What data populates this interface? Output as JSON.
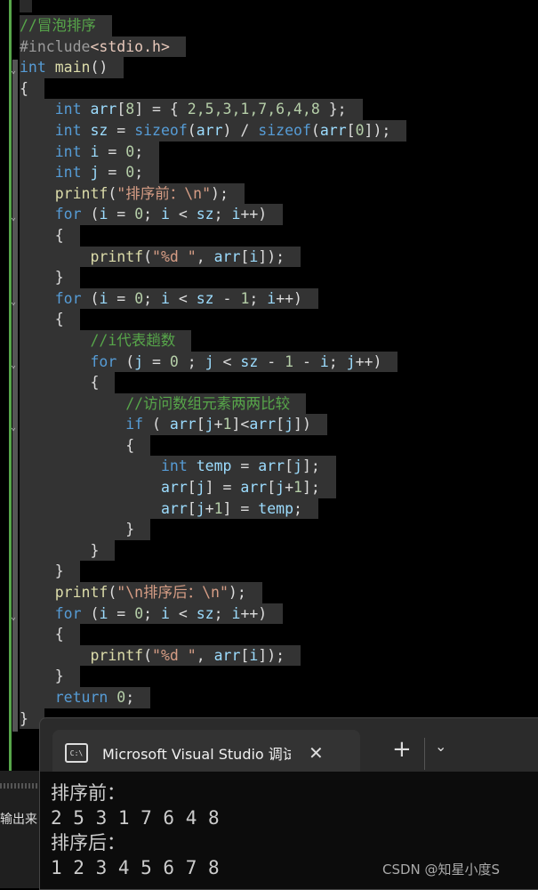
{
  "editor": {
    "lines": [
      [
        [
          0,
          "//冒泡排序",
          "cm"
        ]
      ],
      [
        [
          0,
          "#include",
          "pp"
        ],
        [
          0,
          "<stdio.h>",
          "inc"
        ]
      ],
      [
        [
          0,
          "int ",
          "kw"
        ],
        [
          0,
          "main",
          "fn"
        ],
        [
          0,
          "()",
          "p"
        ]
      ],
      [
        [
          0,
          "{",
          "p"
        ]
      ],
      [
        [
          1,
          "int ",
          "kw"
        ],
        [
          1,
          "arr",
          "var"
        ],
        [
          1,
          "[",
          "p"
        ],
        [
          1,
          "8",
          "num"
        ],
        [
          1,
          "] = { ",
          "p"
        ],
        [
          1,
          "2,5,3,1,7,6,4,8",
          "num"
        ],
        [
          1,
          " };",
          "p"
        ]
      ],
      [
        [
          1,
          "int ",
          "kw"
        ],
        [
          1,
          "sz",
          "var"
        ],
        [
          1,
          " = ",
          "p"
        ],
        [
          1,
          "sizeof",
          "kw"
        ],
        [
          1,
          "(",
          "p"
        ],
        [
          1,
          "arr",
          "var"
        ],
        [
          1,
          ") / ",
          "p"
        ],
        [
          1,
          "sizeof",
          "kw"
        ],
        [
          1,
          "(",
          "p"
        ],
        [
          1,
          "arr",
          "var"
        ],
        [
          1,
          "[",
          "p"
        ],
        [
          1,
          "0",
          "num"
        ],
        [
          1,
          "]);",
          "p"
        ]
      ],
      [
        [
          1,
          "int ",
          "kw"
        ],
        [
          1,
          "i",
          "var"
        ],
        [
          1,
          " = ",
          "p"
        ],
        [
          1,
          "0",
          "num"
        ],
        [
          1,
          ";",
          "p"
        ]
      ],
      [
        [
          1,
          "int ",
          "kw"
        ],
        [
          1,
          "j",
          "var"
        ],
        [
          1,
          " = ",
          "p"
        ],
        [
          1,
          "0",
          "num"
        ],
        [
          1,
          ";",
          "p"
        ]
      ],
      [
        [
          1,
          "printf",
          "fn"
        ],
        [
          1,
          "(",
          "p"
        ],
        [
          1,
          "\"排序前：\\n\"",
          "str"
        ],
        [
          1,
          ");",
          "p"
        ]
      ],
      [
        [
          1,
          "for ",
          "kw"
        ],
        [
          1,
          "(",
          "p"
        ],
        [
          1,
          "i",
          "var"
        ],
        [
          1,
          " = ",
          "p"
        ],
        [
          1,
          "0",
          "num"
        ],
        [
          1,
          "; ",
          "p"
        ],
        [
          1,
          "i",
          "var"
        ],
        [
          1,
          " < ",
          "p"
        ],
        [
          1,
          "sz",
          "var"
        ],
        [
          1,
          "; ",
          "p"
        ],
        [
          1,
          "i",
          "var"
        ],
        [
          1,
          "++)",
          "p"
        ]
      ],
      [
        [
          1,
          "{",
          "p"
        ]
      ],
      [
        [
          2,
          "printf",
          "fn"
        ],
        [
          2,
          "(",
          "p"
        ],
        [
          2,
          "\"%d \"",
          "str"
        ],
        [
          2,
          ", ",
          "p"
        ],
        [
          2,
          "arr",
          "var"
        ],
        [
          2,
          "[",
          "p"
        ],
        [
          2,
          "i",
          "var"
        ],
        [
          2,
          "]);",
          "p"
        ]
      ],
      [
        [
          1,
          "}",
          "p"
        ]
      ],
      [
        [
          1,
          "for ",
          "kw"
        ],
        [
          1,
          "(",
          "p"
        ],
        [
          1,
          "i",
          "var"
        ],
        [
          1,
          " = ",
          "p"
        ],
        [
          1,
          "0",
          "num"
        ],
        [
          1,
          "; ",
          "p"
        ],
        [
          1,
          "i",
          "var"
        ],
        [
          1,
          " < ",
          "p"
        ],
        [
          1,
          "sz",
          "var"
        ],
        [
          1,
          " - ",
          "p"
        ],
        [
          1,
          "1",
          "num"
        ],
        [
          1,
          "; ",
          "p"
        ],
        [
          1,
          "i",
          "var"
        ],
        [
          1,
          "++)",
          "p"
        ]
      ],
      [
        [
          1,
          "{",
          "p"
        ]
      ],
      [
        [
          2,
          "//i代表趟数",
          "cm"
        ]
      ],
      [
        [
          2,
          "for ",
          "kw"
        ],
        [
          2,
          "(",
          "p"
        ],
        [
          2,
          "j",
          "var"
        ],
        [
          2,
          " = ",
          "p"
        ],
        [
          2,
          "0",
          "num"
        ],
        [
          2,
          " ; ",
          "p"
        ],
        [
          2,
          "j",
          "var"
        ],
        [
          2,
          " < ",
          "p"
        ],
        [
          2,
          "sz",
          "var"
        ],
        [
          2,
          " - ",
          "p"
        ],
        [
          2,
          "1",
          "num"
        ],
        [
          2,
          " - ",
          "p"
        ],
        [
          2,
          "i",
          "var"
        ],
        [
          2,
          "; ",
          "p"
        ],
        [
          2,
          "j",
          "var"
        ],
        [
          2,
          "++)",
          "p"
        ]
      ],
      [
        [
          2,
          "{",
          "p"
        ]
      ],
      [
        [
          3,
          "//访问数组元素两两比较",
          "cm"
        ]
      ],
      [
        [
          3,
          "if ",
          "kw"
        ],
        [
          3,
          "( ",
          "p"
        ],
        [
          3,
          "arr",
          "var"
        ],
        [
          3,
          "[",
          "p"
        ],
        [
          3,
          "j",
          "var"
        ],
        [
          3,
          "+",
          "p"
        ],
        [
          3,
          "1",
          "num"
        ],
        [
          3,
          "]<",
          "p"
        ],
        [
          3,
          "arr",
          "var"
        ],
        [
          3,
          "[",
          "p"
        ],
        [
          3,
          "j",
          "var"
        ],
        [
          3,
          "])",
          "p"
        ]
      ],
      [
        [
          3,
          "{",
          "p"
        ]
      ],
      [
        [
          4,
          "int ",
          "kw"
        ],
        [
          4,
          "temp",
          "var"
        ],
        [
          4,
          " = ",
          "p"
        ],
        [
          4,
          "arr",
          "var"
        ],
        [
          4,
          "[",
          "p"
        ],
        [
          4,
          "j",
          "var"
        ],
        [
          4,
          "];",
          "p"
        ]
      ],
      [
        [
          4,
          "arr",
          "var"
        ],
        [
          4,
          "[",
          "p"
        ],
        [
          4,
          "j",
          "var"
        ],
        [
          4,
          "] = ",
          "p"
        ],
        [
          4,
          "arr",
          "var"
        ],
        [
          4,
          "[",
          "p"
        ],
        [
          4,
          "j",
          "var"
        ],
        [
          4,
          "+",
          "p"
        ],
        [
          4,
          "1",
          "num"
        ],
        [
          4,
          "];",
          "p"
        ]
      ],
      [
        [
          4,
          "arr",
          "var"
        ],
        [
          4,
          "[",
          "p"
        ],
        [
          4,
          "j",
          "var"
        ],
        [
          4,
          "+",
          "p"
        ],
        [
          4,
          "1",
          "num"
        ],
        [
          4,
          "] = ",
          "p"
        ],
        [
          4,
          "temp",
          "var"
        ],
        [
          4,
          ";",
          "p"
        ]
      ],
      [
        [
          3,
          "}",
          "p"
        ]
      ],
      [
        [
          2,
          "}",
          "p"
        ]
      ],
      [
        [
          1,
          "}",
          "p"
        ]
      ],
      [
        [
          1,
          "printf",
          "fn"
        ],
        [
          1,
          "(",
          "p"
        ],
        [
          1,
          "\"\\n排序后：\\n\"",
          "str"
        ],
        [
          1,
          ");",
          "p"
        ]
      ],
      [
        [
          1,
          "for ",
          "kw"
        ],
        [
          1,
          "(",
          "p"
        ],
        [
          1,
          "i",
          "var"
        ],
        [
          1,
          " = ",
          "p"
        ],
        [
          1,
          "0",
          "num"
        ],
        [
          1,
          "; ",
          "p"
        ],
        [
          1,
          "i",
          "var"
        ],
        [
          1,
          " < ",
          "p"
        ],
        [
          1,
          "sz",
          "var"
        ],
        [
          1,
          "; ",
          "p"
        ],
        [
          1,
          "i",
          "var"
        ],
        [
          1,
          "++)",
          "p"
        ]
      ],
      [
        [
          1,
          "{",
          "p"
        ]
      ],
      [
        [
          2,
          "printf",
          "fn"
        ],
        [
          2,
          "(",
          "p"
        ],
        [
          2,
          "\"%d \"",
          "str"
        ],
        [
          2,
          ", ",
          "p"
        ],
        [
          2,
          "arr",
          "var"
        ],
        [
          2,
          "[",
          "p"
        ],
        [
          2,
          "i",
          "var"
        ],
        [
          2,
          "]);",
          "p"
        ]
      ],
      [
        [
          1,
          "}",
          "p"
        ]
      ],
      [
        [
          1,
          "return ",
          "kw"
        ],
        [
          1,
          "0",
          "num"
        ],
        [
          1,
          ";",
          "p"
        ]
      ],
      [
        [
          0,
          "}",
          "p"
        ]
      ]
    ],
    "fold_lines": [
      2,
      9,
      13,
      16,
      19,
      28
    ]
  },
  "output_panel": {
    "text": "输出来"
  },
  "console": {
    "tab_title": "Microsoft Visual Studio 调试控",
    "tab_icon": "C:\\",
    "close": "✕",
    "new_tab": "+",
    "dropdown": "⌄",
    "output": [
      "排序前：",
      "2 5 3 1 7 6 4 8",
      "排序后：",
      "1 2 3 4 5 6 7 8"
    ]
  },
  "watermark": "CSDN @知星小度S"
}
